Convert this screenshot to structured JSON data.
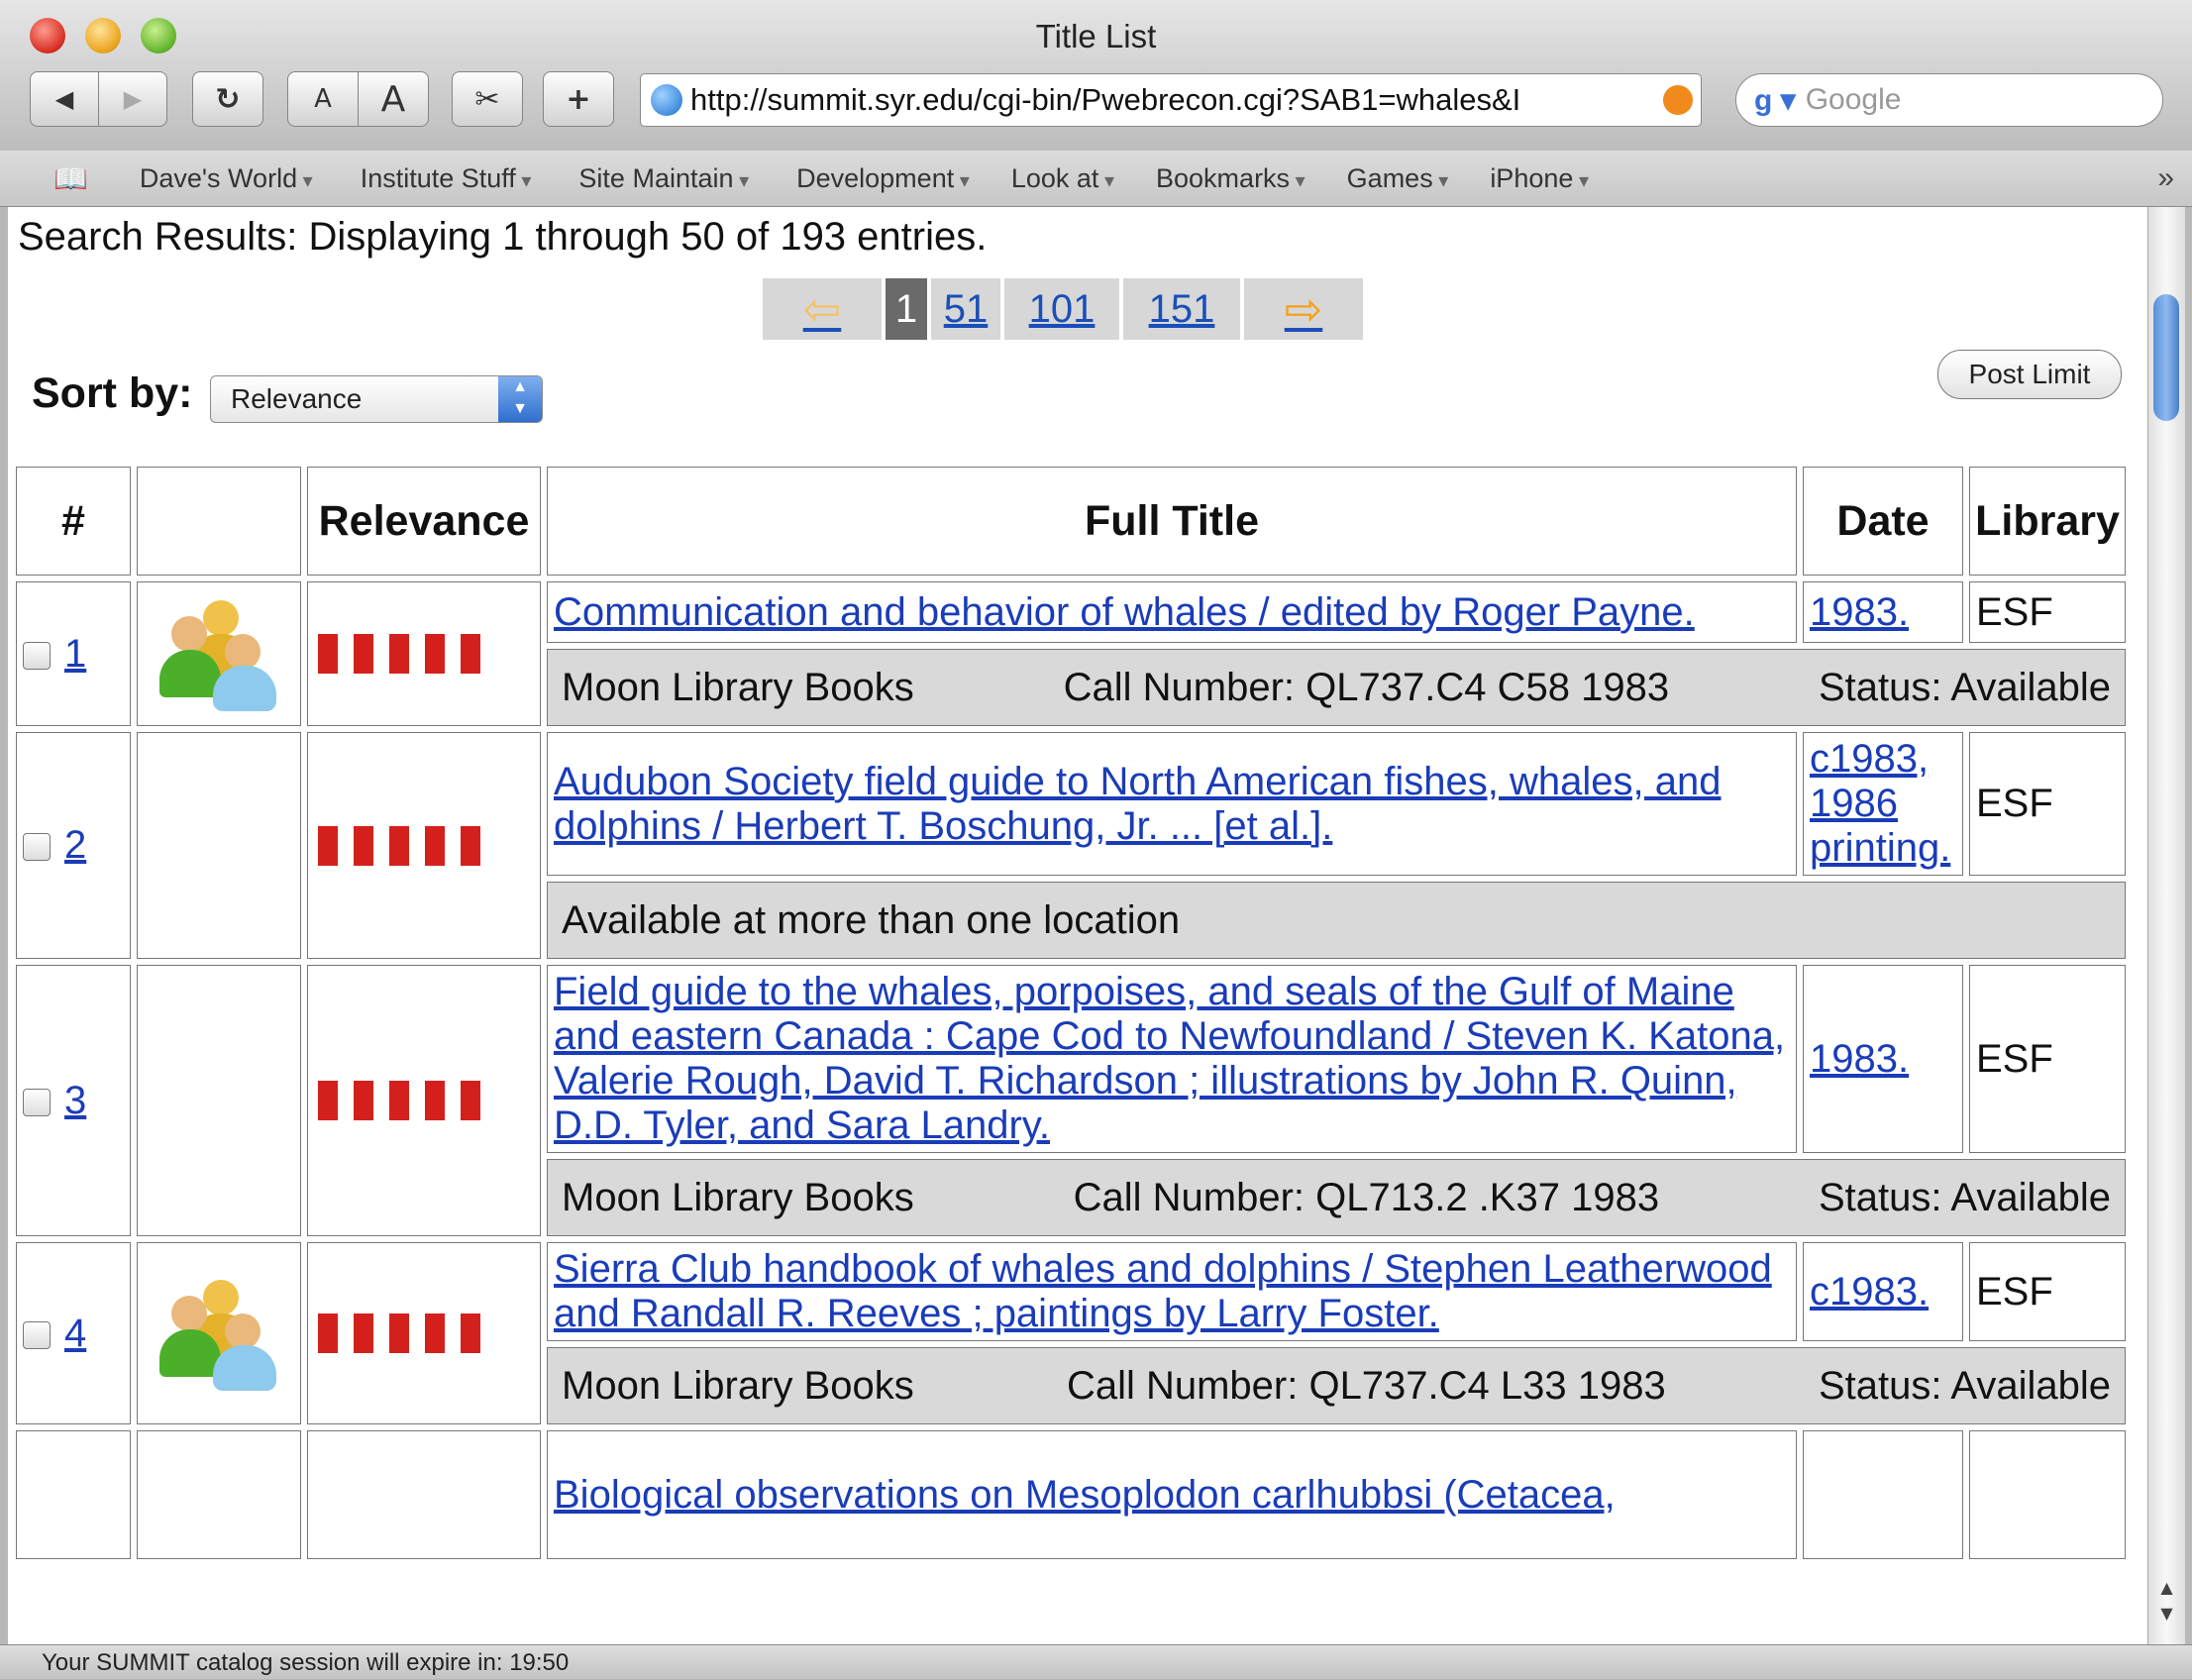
{
  "window": {
    "title": "Title List"
  },
  "toolbar": {
    "back_label": "◀",
    "forward_label": "▶",
    "reload_label": "↻",
    "text_smaller": "A",
    "text_bigger": "A",
    "add_label": "+"
  },
  "address": {
    "url": "http://summit.syr.edu/cgi-bin/Pwebrecon.cgi?SAB1=whales&I"
  },
  "search": {
    "placeholder": "Google"
  },
  "bookmarks": [
    "Dave's World",
    "Institute Stuff",
    "Site Maintain",
    "Development",
    "Look at",
    "Bookmarks",
    "Games",
    "iPhone"
  ],
  "results": {
    "summary": "Search Results: Displaying 1 through 50 of 193 entries.",
    "pages": [
      "1",
      "51",
      "101",
      "151"
    ],
    "sort_label": "Sort by:",
    "sort_value": "Relevance",
    "post_limit": "Post Limit"
  },
  "table": {
    "headers": [
      "#",
      "",
      "Relevance",
      "Full Title",
      "Date",
      "Library"
    ],
    "rows": [
      {
        "num": "1",
        "title": "Communication and behavior of whales / edited by Roger Payne.",
        "date": "1983.",
        "library": "ESF",
        "has_icon": true,
        "sub": [
          "Moon Library Books",
          "Call Number: QL737.C4 C58 1983",
          "Status: Available"
        ]
      },
      {
        "num": "2",
        "title": "Audubon Society field guide to North American fishes, whales, and dolphins / Herbert T. Boschung, Jr. ... [et al.].",
        "date": "c1983, 1986 printing.",
        "library": "ESF",
        "has_icon": false,
        "sub": [
          "Available at more than one location"
        ]
      },
      {
        "num": "3",
        "title": "Field guide to the whales, porpoises, and seals of the Gulf of Maine and eastern Canada : Cape Cod to Newfoundland / Steven K. Katona, Valerie Rough, David T. Richardson ; illustrations by John R. Quinn, D.D. Tyler, and Sara Landry.",
        "date": "1983.",
        "library": "ESF",
        "has_icon": false,
        "sub": [
          "Moon Library Books",
          "Call Number: QL713.2 .K37 1983",
          "Status: Available"
        ]
      },
      {
        "num": "4",
        "title": "Sierra Club handbook of whales and dolphins / Stephen Leatherwood and Randall R. Reeves ; paintings by Larry Foster.",
        "date": "c1983.",
        "library": "ESF",
        "has_icon": true,
        "sub": [
          "Moon Library Books",
          "Call Number: QL737.C4 L33 1983",
          "Status: Available"
        ]
      },
      {
        "num": "",
        "title": "Biological observations on Mesoplodon carlhubbsi (Cetacea,",
        "date": "",
        "library": "",
        "has_icon": false,
        "sub": []
      }
    ]
  },
  "status": {
    "text": "Your SUMMIT catalog session will expire in: 19:50"
  }
}
